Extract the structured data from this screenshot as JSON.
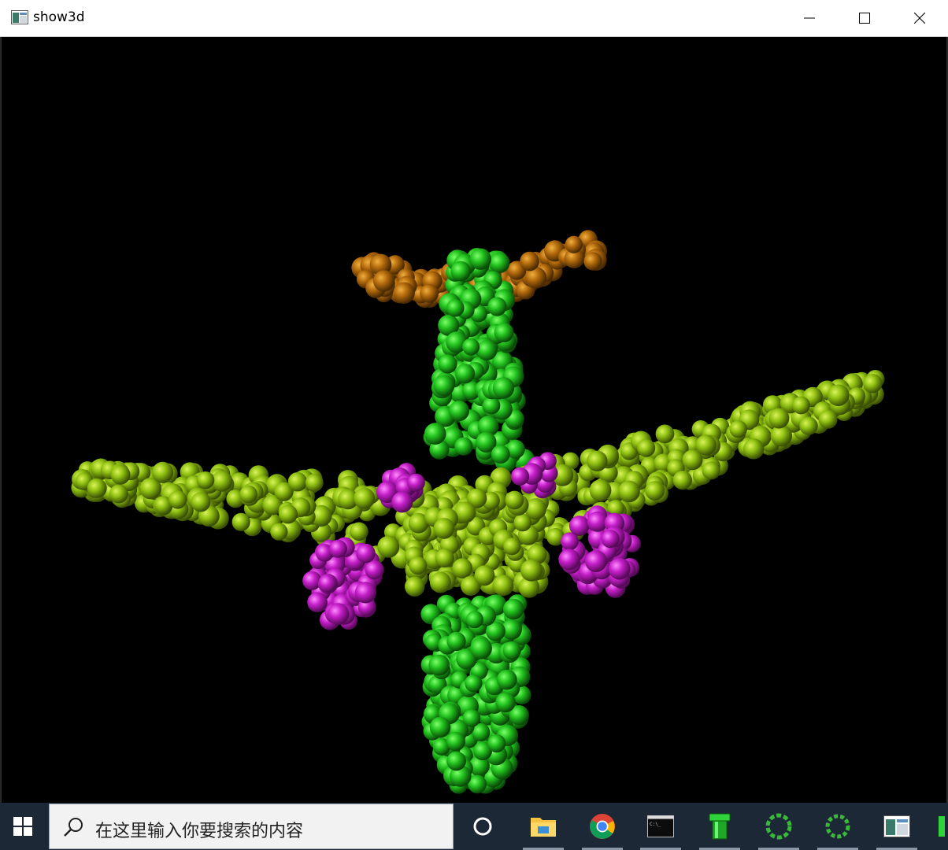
{
  "window": {
    "title": "show3d",
    "controls": [
      "minimize",
      "maximize",
      "close"
    ]
  },
  "scene": {
    "description_colors": {
      "fuselage": "#22c21e",
      "wings": "#8fc011",
      "tail": "#b36a0c",
      "engines": "#c51ec9"
    }
  },
  "taskbar": {
    "search_placeholder": "在这里输入你要搜索的内容",
    "apps": [
      "cortana-icon",
      "file-explorer-icon",
      "chrome-icon",
      "terminal-icon",
      "pipe-app-icon",
      "loading-ring-icon",
      "loading-ring-icon",
      "window-app-icon"
    ]
  }
}
